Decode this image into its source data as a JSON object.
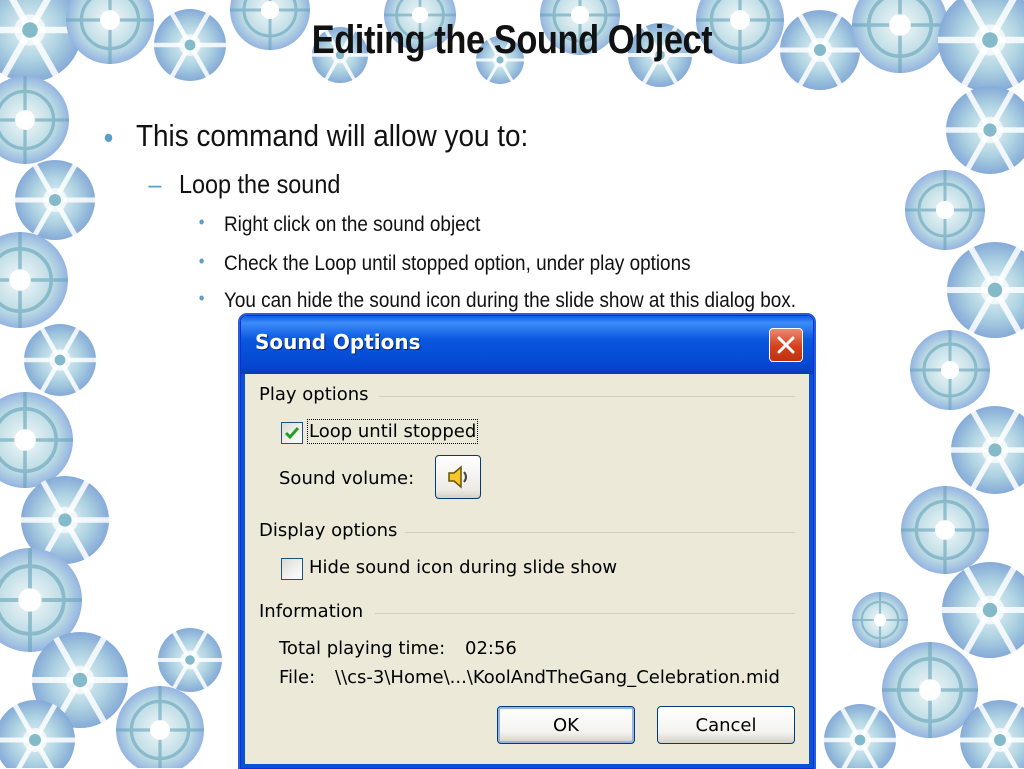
{
  "slide": {
    "title": "Editing the Sound Object",
    "bullet_marker": "•",
    "dash_marker": "–",
    "level1": "This command will allow you to:",
    "level2": "Loop the sound",
    "level3": [
      "Right click on the sound object",
      "Check the Loop until stopped option, under play options",
      "You can hide the sound icon during the slide show at this dialog box."
    ],
    "stray_mark": "-"
  },
  "dialog": {
    "title": "Sound Options",
    "play_options": {
      "heading": "Play options",
      "loop_label": "Loop until stopped",
      "loop_checked": true,
      "volume_label": "Sound volume:"
    },
    "display_options": {
      "heading": "Display options",
      "hide_label": "Hide sound icon during slide show",
      "hide_checked": false
    },
    "information": {
      "heading": "Information",
      "time_label": "Total playing time:",
      "time_value": "02:56",
      "file_label": "File:",
      "file_value": "\\\\cs-3\\Home\\...\\KoolAndTheGang_Celebration.mid"
    },
    "ok_label": "OK",
    "cancel_label": "Cancel"
  },
  "icons": {
    "close": "close-icon",
    "speaker": "speaker-icon",
    "check": "checkmark-icon"
  },
  "colors": {
    "titlebar": "#0a58e0",
    "close_button": "#d5401c",
    "dialog_face": "#ece9d8",
    "bullet": "#5aa0c8"
  }
}
